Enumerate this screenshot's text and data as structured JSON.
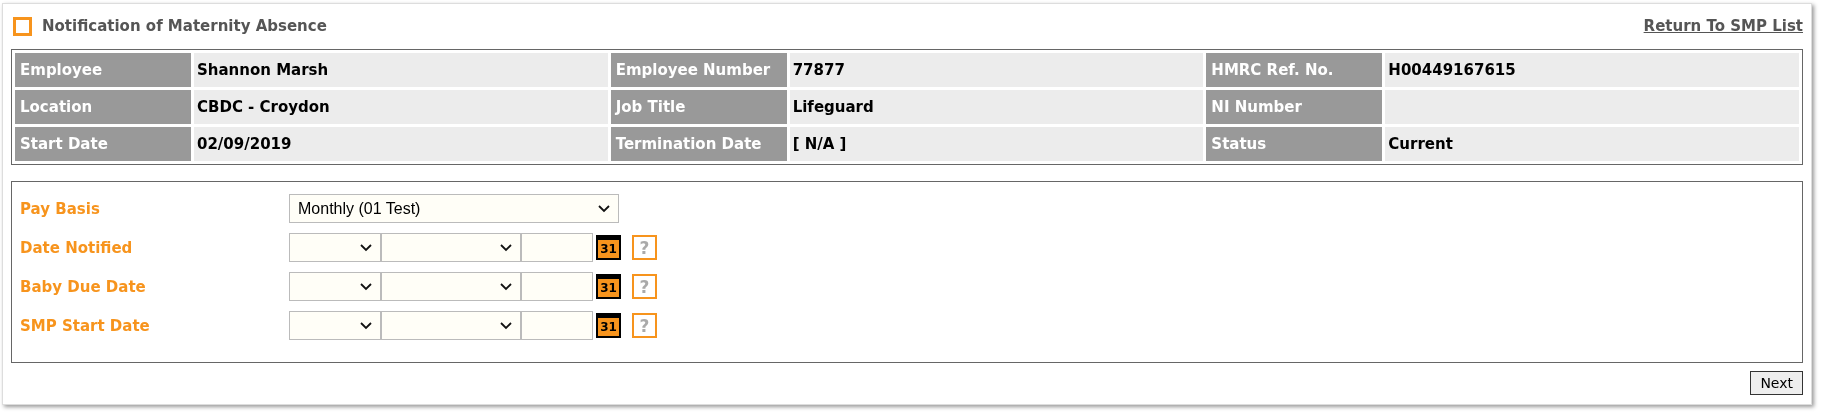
{
  "header": {
    "title": "Notification of Maternity Absence",
    "link": "Return To SMP List"
  },
  "employee_info": [
    [
      {
        "label": "Employee",
        "value": "Shannon Marsh"
      },
      {
        "label": "Employee Number",
        "value": "77877"
      },
      {
        "label": "HMRC Ref. No.",
        "value": "H00449167615"
      }
    ],
    [
      {
        "label": "Location",
        "value": "CBDC - Croydon"
      },
      {
        "label": "Job Title",
        "value": "Lifeguard"
      },
      {
        "label": "NI Number"
      }
    ],
    [
      {
        "label": "Start Date",
        "value": "02/09/2019"
      },
      {
        "label": "Termination Date",
        "value": "[ N/A ]"
      },
      {
        "label": "Status",
        "value": "Current"
      }
    ]
  ],
  "form": [
    {
      "kind": "select",
      "label": "Pay Basis",
      "value": "Monthly (01 Test)"
    },
    {
      "kind": "date",
      "label": "Date Notified",
      "calendar": "31",
      "help": "?"
    },
    {
      "kind": "date",
      "label": "Baby Due Date",
      "calendar": "31",
      "help": "?"
    },
    {
      "kind": "date",
      "label": "SMP Start Date",
      "calendar": "31",
      "help": "?"
    }
  ],
  "buttons": [
    "Next"
  ]
}
